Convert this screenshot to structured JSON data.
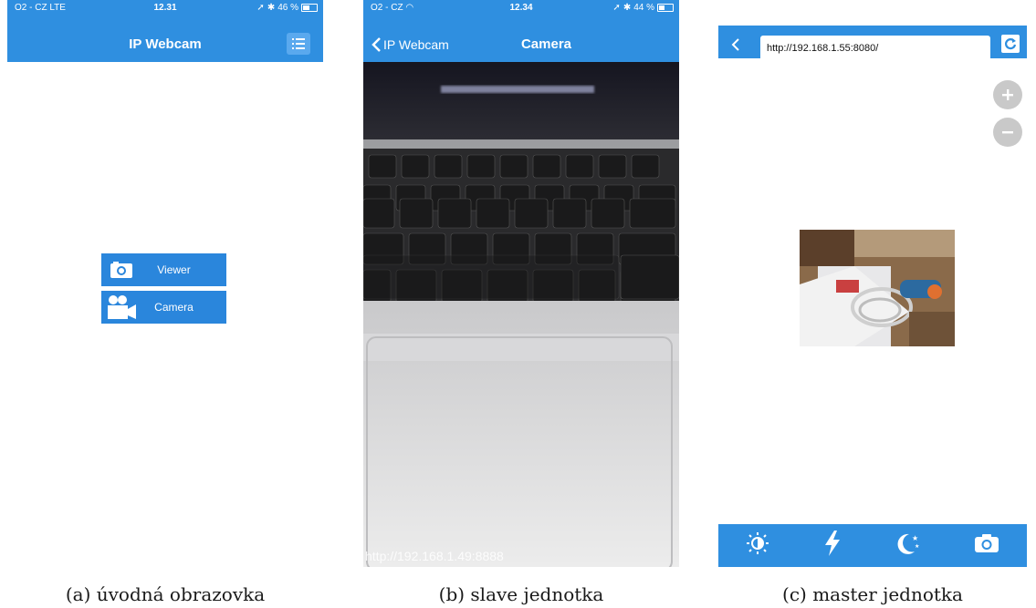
{
  "panels": {
    "home": {
      "status": {
        "carrier": "O2 - CZ  LTE",
        "time": "12.31",
        "battery": "46 %"
      },
      "title": "IP Webcam",
      "buttons": [
        {
          "label": "Viewer",
          "icon": "camera-icon"
        },
        {
          "label": "Camera",
          "icon": "video-camera-icon"
        }
      ],
      "caption": "(a) úvodná obrazovka"
    },
    "slave": {
      "status": {
        "carrier": "O2 - CZ",
        "time": "12.34",
        "battery": "44 %"
      },
      "back_label": "IP Webcam",
      "title": "Camera",
      "stream_url": "http://192.168.1.49:8888",
      "caption": "(b) slave jednotka"
    },
    "master": {
      "address": "http://192.168.1.55:8080/",
      "toolbar": [
        "brightness-icon",
        "flash-icon",
        "night-mode-icon",
        "camera-icon"
      ],
      "caption": "(c) master jednotka"
    }
  },
  "colors": {
    "accent": "#2f8fe0"
  }
}
